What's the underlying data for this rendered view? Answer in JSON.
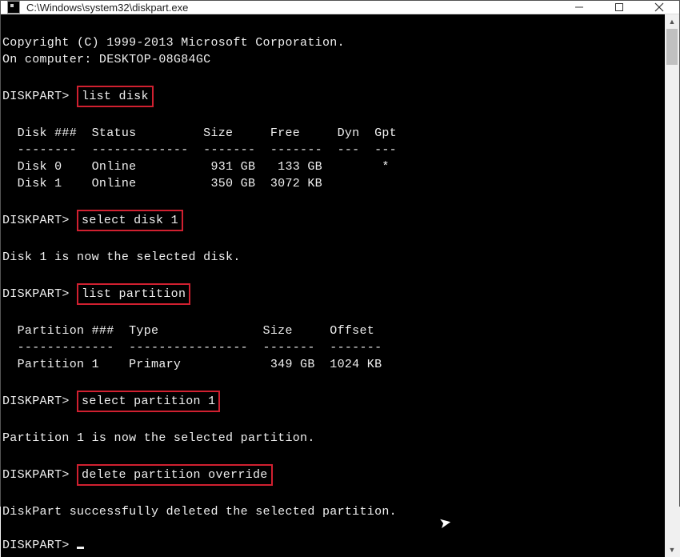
{
  "window": {
    "title": "C:\\Windows\\system32\\diskpart.exe"
  },
  "console": {
    "copyright": "Copyright (C) 1999-2013 Microsoft Corporation.",
    "computer_line": "On computer: DESKTOP-08G84GC",
    "prompt": "DISKPART>",
    "blank": "",
    "cmd1": "list disk",
    "disk_header": "  Disk ###  Status         Size     Free     Dyn  Gpt",
    "disk_sep": "  --------  -------------  -------  -------  ---  ---",
    "disk_row0": "  Disk 0    Online          931 GB   133 GB        *",
    "disk_row1": "  Disk 1    Online          350 GB  3072 KB",
    "cmd2": "select disk 1",
    "msg_disk_selected": "Disk 1 is now the selected disk.",
    "cmd3": "list partition",
    "part_header": "  Partition ###  Type              Size     Offset",
    "part_sep": "  -------------  ----------------  -------  -------",
    "part_row0": "  Partition 1    Primary            349 GB  1024 KB",
    "cmd4": "select partition 1",
    "msg_part_selected": "Partition 1 is now the selected partition.",
    "cmd5": "delete partition override",
    "msg_deleted": "DiskPart successfully deleted the selected partition."
  },
  "chart_data": {
    "type": "table",
    "disks": {
      "columns": [
        "Disk ###",
        "Status",
        "Size",
        "Free",
        "Dyn",
        "Gpt"
      ],
      "rows": [
        {
          "disk": "Disk 0",
          "status": "Online",
          "size": "931 GB",
          "free": "133 GB",
          "dyn": "",
          "gpt": "*"
        },
        {
          "disk": "Disk 1",
          "status": "Online",
          "size": "350 GB",
          "free": "3072 KB",
          "dyn": "",
          "gpt": ""
        }
      ]
    },
    "partitions": {
      "columns": [
        "Partition ###",
        "Type",
        "Size",
        "Offset"
      ],
      "rows": [
        {
          "partition": "Partition 1",
          "type": "Primary",
          "size": "349 GB",
          "offset": "1024 KB"
        }
      ]
    }
  }
}
